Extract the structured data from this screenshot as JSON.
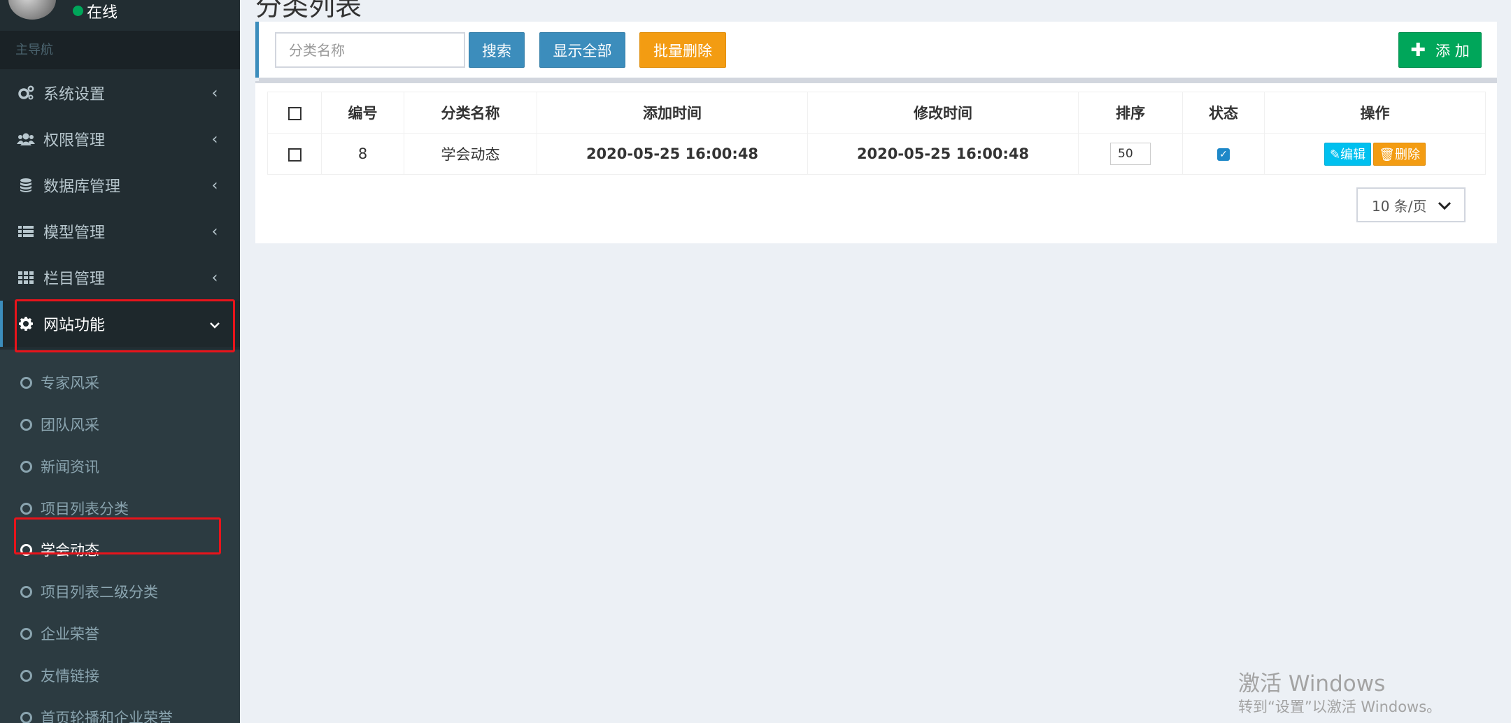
{
  "user": {
    "status": "在线"
  },
  "sidebar": {
    "header": "主导航",
    "items": [
      {
        "label": "系统设置",
        "icon": "gears-icon"
      },
      {
        "label": "权限管理",
        "icon": "users-icon"
      },
      {
        "label": "数据库管理",
        "icon": "database-icon"
      },
      {
        "label": "模型管理",
        "icon": "list-icon"
      },
      {
        "label": "栏目管理",
        "icon": "grid-icon"
      },
      {
        "label": "网站功能",
        "icon": "gear-icon"
      }
    ],
    "sub_items": [
      {
        "label": "专家风采"
      },
      {
        "label": "团队风采"
      },
      {
        "label": "新闻资讯"
      },
      {
        "label": "项目列表分类"
      },
      {
        "label": "学会动态"
      },
      {
        "label": "项目列表二级分类"
      },
      {
        "label": "企业荣誉"
      },
      {
        "label": "友情链接"
      },
      {
        "label": "首页轮播和企业荣誉"
      }
    ]
  },
  "page": {
    "title": "分类列表"
  },
  "toolbar": {
    "search_placeholder": "分类名称",
    "search_label": "搜索",
    "show_all_label": "显示全部",
    "batch_delete_label": "批量删除",
    "add_label": "添 加"
  },
  "table": {
    "headers": [
      "编号",
      "分类名称",
      "添加时间",
      "修改时间",
      "排序",
      "状态",
      "操作"
    ],
    "rows": [
      {
        "id": "8",
        "name": "学会动态",
        "created": "2020-05-25 16:00:48",
        "modified": "2020-05-25 16:00:48",
        "sort": "50",
        "status": true
      }
    ],
    "edit_label": "编辑",
    "delete_label": "删除"
  },
  "pagination": {
    "page_size": "10 条/页"
  },
  "watermark": {
    "title": "激活 Windows",
    "subtitle": "转到“设置”以激活 Windows。"
  },
  "colors": {
    "sidebar": "#222d32",
    "primary": "#3c8dbc",
    "warning": "#f39c12",
    "success": "#00a65a",
    "info": "#00c0ef",
    "highlight": "#e8141b"
  }
}
